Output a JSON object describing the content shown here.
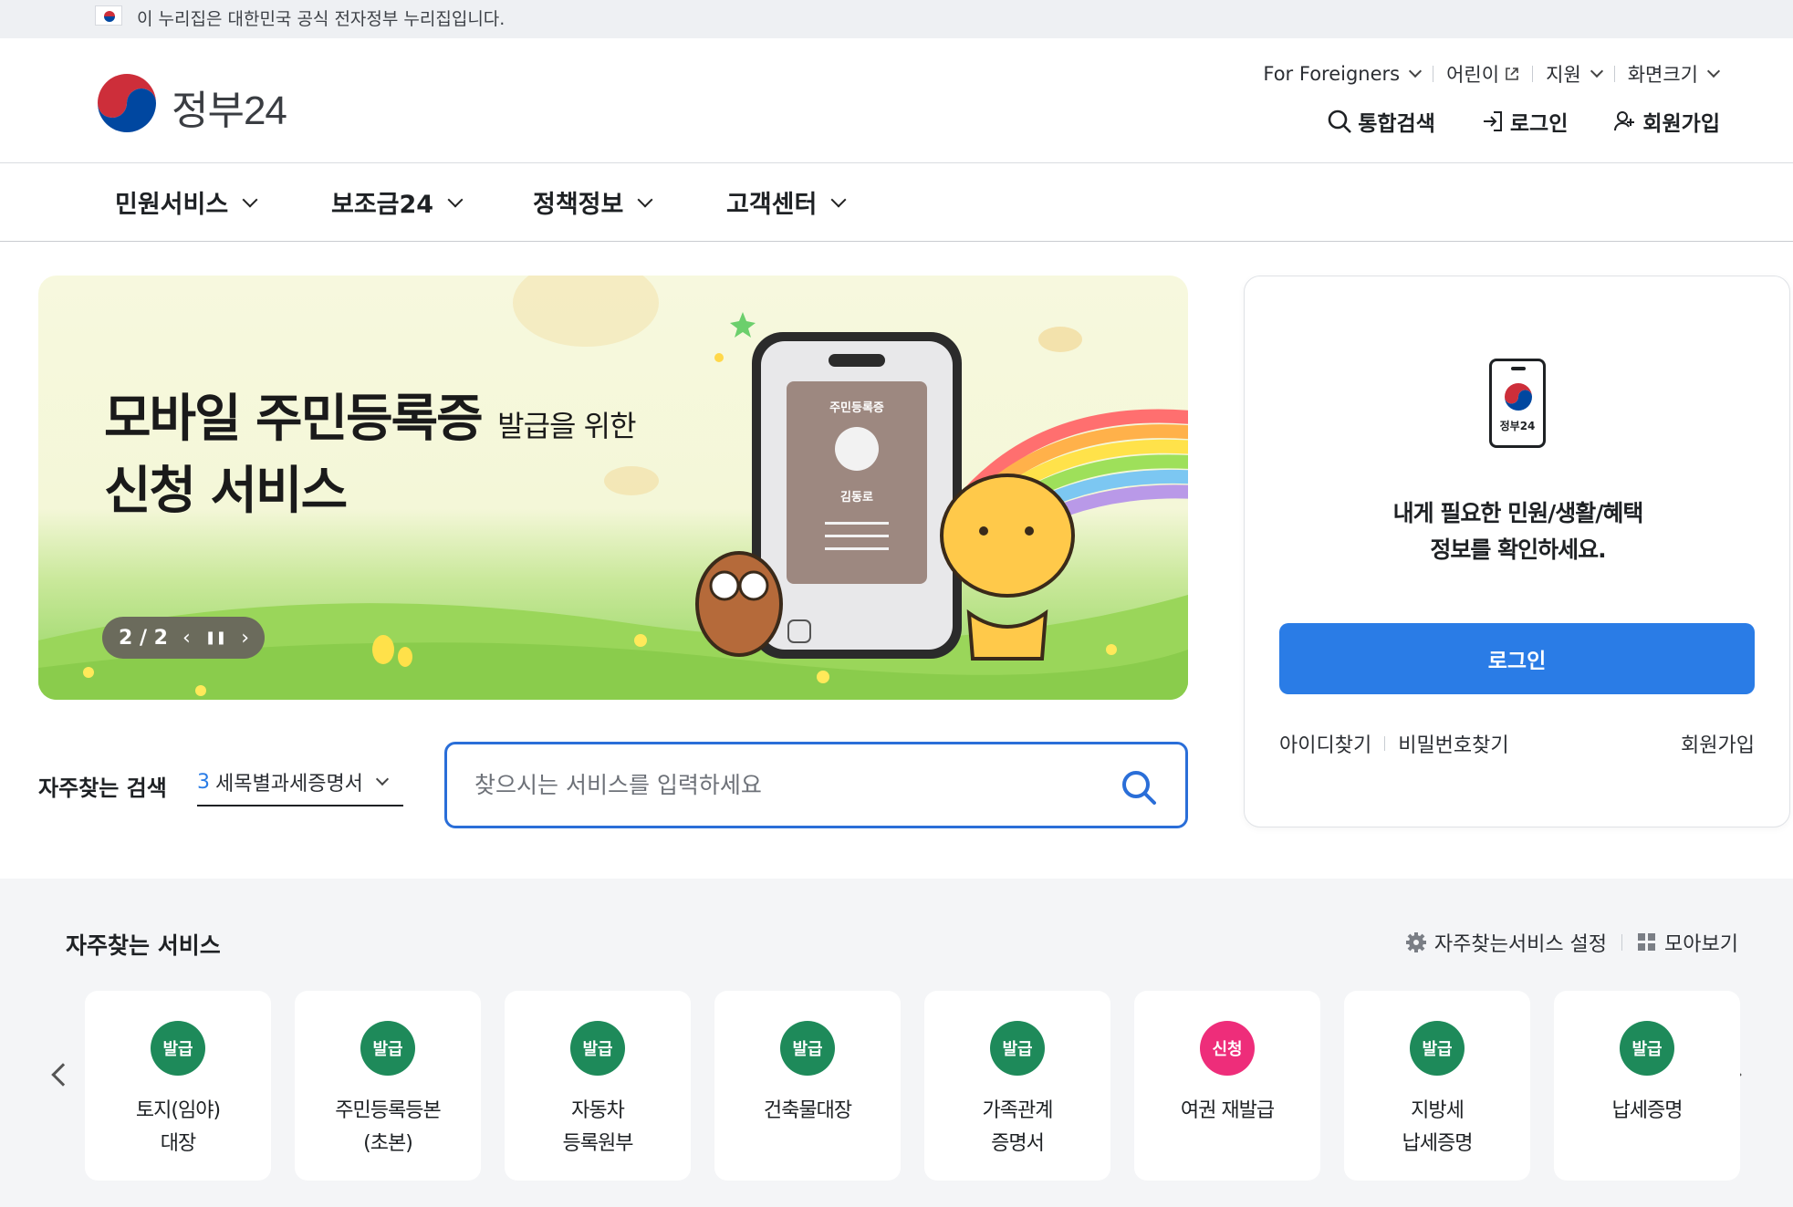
{
  "gov_banner": {
    "text": "이 누리집은 대한민국 공식 전자정부 누리집입니다."
  },
  "header": {
    "logo_text": "정부24",
    "util_links": [
      "For Foreigners",
      "어린이",
      "지원",
      "화면크기"
    ],
    "actions": {
      "search": "통합검색",
      "login": "로그인",
      "signup": "회원가입"
    }
  },
  "gnb": {
    "items": [
      "민원서비스",
      "보조금24",
      "정책정보",
      "고객센터"
    ]
  },
  "hero": {
    "title_strong_1": "모바일 주민등록증",
    "title_small": "발급을 위한",
    "title_strong_2": "신청 서비스",
    "counter": "2 / 2",
    "id_card_label": "주민등록증",
    "id_card_name": "김동로",
    "bg_color": "#f6f7dc"
  },
  "login_card": {
    "icon_label": "정부24",
    "message_line1": "내게 필요한 민원/생활/혜택",
    "message_line2": "정보를 확인하세요.",
    "login_button": "로그인",
    "find_id": "아이디찾기",
    "find_pw": "비밀번호찾기",
    "signup": "회원가입",
    "accent_color": "#2a7ce6"
  },
  "frequent_search": {
    "label": "자주찾는 검색",
    "selected_num": "3",
    "selected_text": "세목별과세증명서",
    "placeholder": "찾으시는 서비스를 입력하세요"
  },
  "services": {
    "title": "자주찾는 서비스",
    "settings": "자주찾는서비스 설정",
    "view_all": "모아보기",
    "items": [
      {
        "badge": "발급",
        "name": "토지(임야)\n대장",
        "color": "#1e8a5a"
      },
      {
        "badge": "발급",
        "name": "주민등록등본\n(초본)",
        "color": "#1e8a5a"
      },
      {
        "badge": "발급",
        "name": "자동차\n등록원부",
        "color": "#1e8a5a"
      },
      {
        "badge": "발급",
        "name": "건축물대장",
        "color": "#1e8a5a"
      },
      {
        "badge": "발급",
        "name": "가족관계\n증명서",
        "color": "#1e8a5a"
      },
      {
        "badge": "신청",
        "name": "여권 재발급",
        "color": "#ee2d7a"
      },
      {
        "badge": "발급",
        "name": "지방세\n납세증명",
        "color": "#1e8a5a"
      },
      {
        "badge": "발급",
        "name": "납세증명",
        "color": "#1e8a5a"
      }
    ]
  }
}
